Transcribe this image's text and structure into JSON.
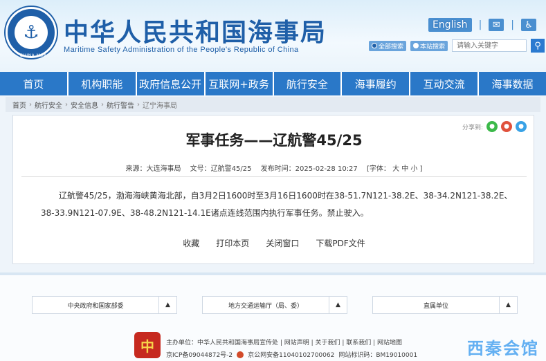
{
  "header": {
    "logo_text": "CHINA MSA",
    "title": "中华人民共和国海事局",
    "subtitle": "Maritime Safety Administration of the People's Republic of China",
    "english_link": "English",
    "search": {
      "radio_site": "全部搜索",
      "radio_other": "本站搜索",
      "placeholder": "请输入关键字"
    }
  },
  "nav": {
    "items": [
      {
        "label": "首页"
      },
      {
        "label": "机构职能"
      },
      {
        "label": "政府信息公开"
      },
      {
        "label": "互联网+政务"
      },
      {
        "label": "航行安全"
      },
      {
        "label": "海事履约"
      },
      {
        "label": "互动交流"
      },
      {
        "label": "海事数据"
      }
    ]
  },
  "breadcrumb": {
    "items": [
      "首页",
      "航行安全",
      "安全信息",
      "航行警告",
      "辽宁海事局"
    ]
  },
  "article": {
    "share_label": "分享到:",
    "title": "军事任务——辽航警45/25",
    "meta": {
      "source": "来源：大连海事局",
      "doc_no": "文号：辽航警45/25",
      "published": "发布时间：2025-02-28 10:27",
      "font_size": "[字体： 大  中  小 ]"
    },
    "body": "辽航警45/25，渤海海峡黄海北部，自3月2日1600时至3月16日1600时在38-51.7N121-38.2E、38-34.2N121-38.2E、38-33.9N121-07.9E、38-48.2N121-14.1E诸点连线范围内执行军事任务。禁止驶入。",
    "actions": {
      "favorite": "收藏",
      "print": "打印本页",
      "close": "关闭窗口",
      "download_pdf": "下载PDF文件"
    }
  },
  "footer": {
    "selects": [
      {
        "label": "中央政府和国家部委"
      },
      {
        "label": "地方交通运输厅（局、委）"
      },
      {
        "label": "直属单位"
      }
    ],
    "line1": "主办单位：中华人民共和国海事局宣传处 | 网站声明 | 关于我们 | 联系我们 | 网站地图",
    "icp": "京ICP备09044872号-2",
    "police": "京公网安备11040102700062",
    "site_code": "网站标识码：BM19010001",
    "watermark": "西秦会馆"
  },
  "colors": {
    "brand_blue": "#1f5fa8",
    "nav_blue": "#2a78c8",
    "accent_red": "#c6291f"
  }
}
